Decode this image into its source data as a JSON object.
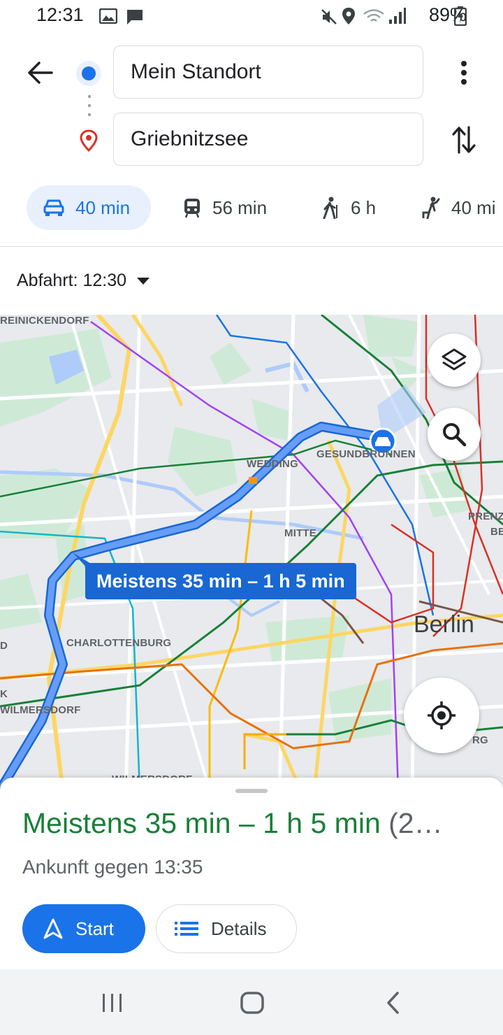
{
  "status_bar": {
    "time": "12:31",
    "battery": "89%",
    "icons": [
      "gallery-icon",
      "message-icon",
      "mute-icon",
      "location-icon",
      "wifi-icon",
      "signal-icon",
      "battery-icon"
    ]
  },
  "header": {
    "origin": "Mein Standort",
    "destination": "Griebnitzsee"
  },
  "modes": [
    {
      "icon": "car-icon",
      "label": "40 min",
      "active": true
    },
    {
      "icon": "transit-icon",
      "label": "56 min",
      "active": false
    },
    {
      "icon": "walk-icon",
      "label": "6 h",
      "active": false
    },
    {
      "icon": "rideshare-icon",
      "label": "40 mi",
      "active": false
    }
  ],
  "departure": "Abfahrt: 12:30",
  "map": {
    "labels": {
      "reinickendorf": "REINICKENDORF",
      "wedding": "WEDDING",
      "gesundbrunnen": "GESUNDBRUNNEN",
      "mitte": "MITTE",
      "prenz": "PRENZ",
      "be": "BE",
      "berlin": "Berlin",
      "charlottenburg": "CHARLOTTENBURG",
      "wilmersdorf": "WILMERSDORF",
      "d": "D",
      "k": "K",
      "rg": "RG",
      "wilmersdorf2": "WILMERSDORF"
    },
    "tooltip": "Meistens 35 min – 1 h 5 min"
  },
  "sheet": {
    "summary": "Meistens 35 min – 1 h 5 min",
    "summary_extra": "(2…",
    "arrival": "Ankunft gegen 13:35",
    "start_label": "Start",
    "details_label": "Details"
  },
  "colors": {
    "accent": "#1a73e8",
    "route": "#669df6",
    "green_text": "#188038"
  }
}
